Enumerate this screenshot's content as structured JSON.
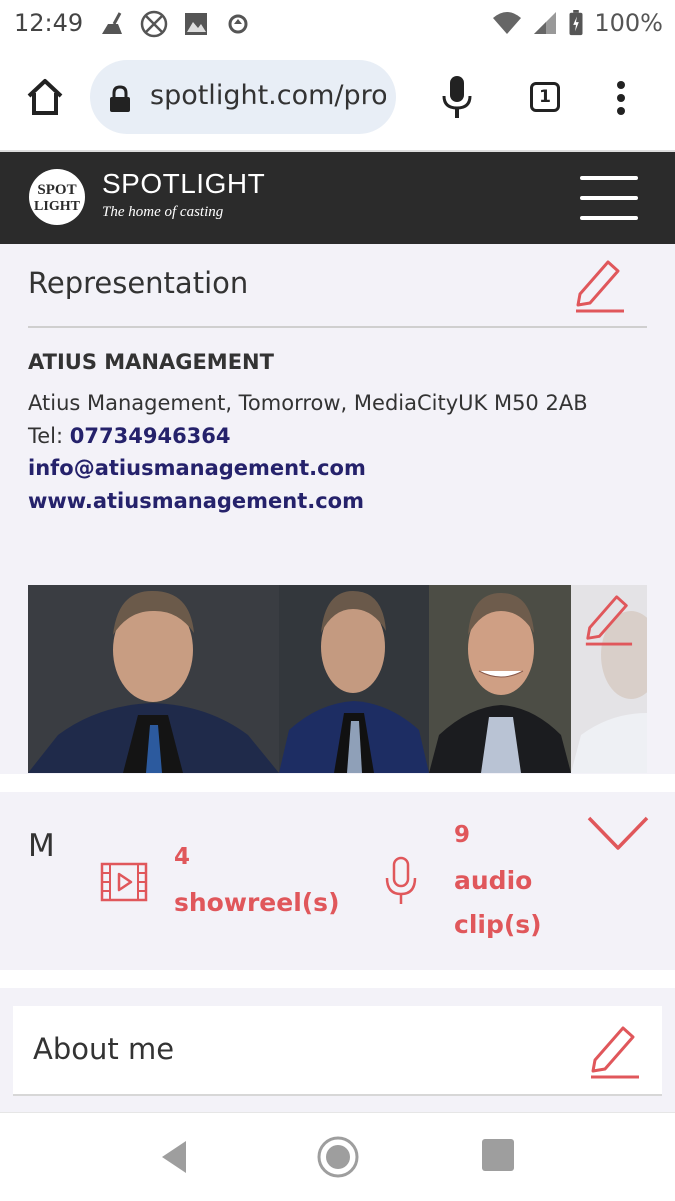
{
  "status_bar": {
    "time": "12:49",
    "battery": "100%",
    "icons": [
      "cleaner-icon",
      "no-sim-icon",
      "gallery-icon",
      "sync-icon",
      "wifi-icon",
      "signal-icon",
      "battery-charging-icon"
    ]
  },
  "browser": {
    "url": "spotlight.com/profile",
    "tab_count": "1",
    "icons": [
      "home-icon",
      "lock-icon",
      "mic-icon",
      "tabs-icon",
      "more-vert-icon"
    ]
  },
  "site_header": {
    "brand": "SPOTLIGHT",
    "tagline": "The home of casting",
    "logo_text": "SPOTLIGHT",
    "background_color": "#2b2b2b"
  },
  "representation": {
    "heading": "Representation",
    "agency_name": "ATIUS MANAGEMENT",
    "address": "Atius Management, Tomorrow, MediaCityUK M50 2AB",
    "tel_label": "Tel:",
    "tel": "07734946364",
    "email": "info@atiusmanagement.com",
    "website": "www.atiusmanagement.com",
    "photos": [
      "headshot-1",
      "headshot-2",
      "headshot-3",
      "headshot-4"
    ]
  },
  "media": {
    "title": "M",
    "showreels_count": "4",
    "showreels_label": "showreel(s)",
    "audio_count": "9",
    "audio_label_line1": "audio",
    "audio_label_line2": "clip(s)"
  },
  "about": {
    "heading": "About me"
  },
  "colors": {
    "accent": "#e0575b",
    "link": "#25226b",
    "section_bg": "#f3f2f8"
  }
}
